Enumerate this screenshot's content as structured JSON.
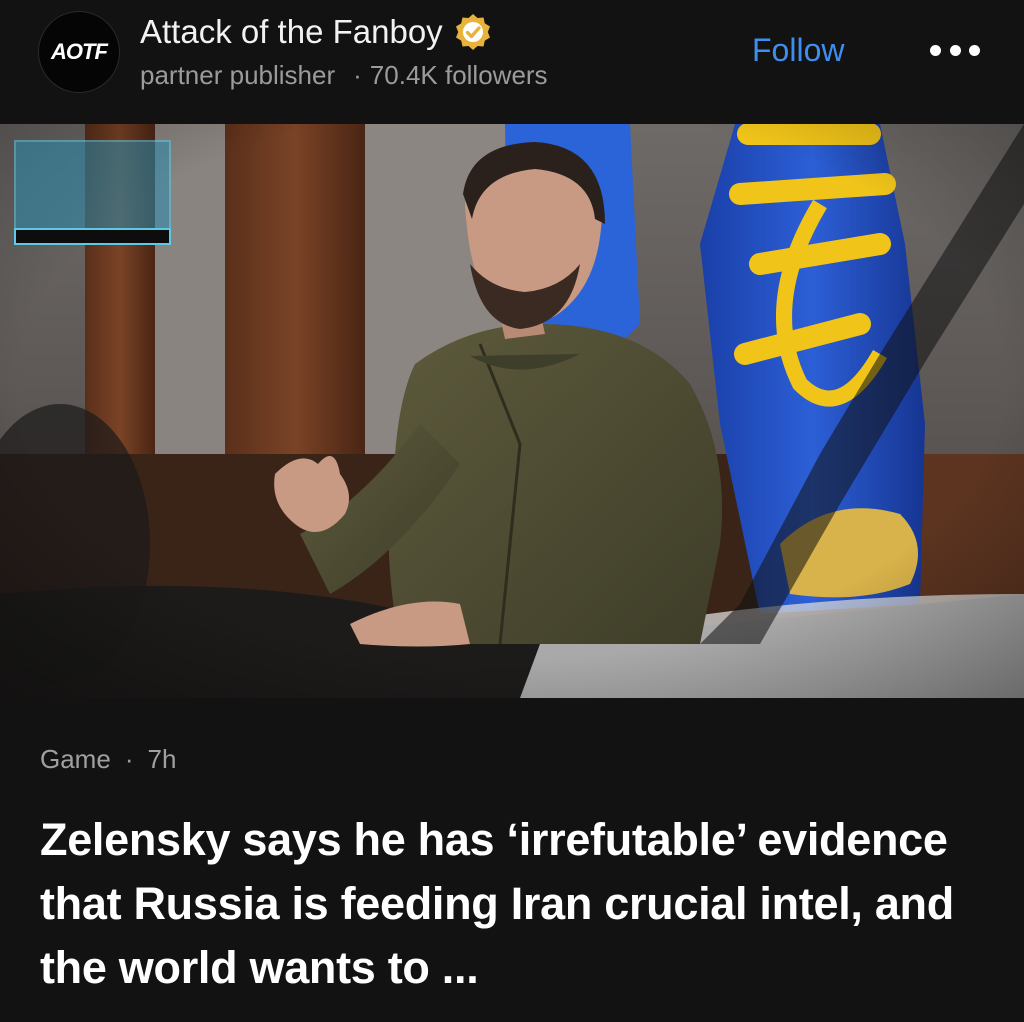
{
  "publisher": {
    "logo_text": "AOTF",
    "name": "Attack of the Fanboy",
    "type": "partner publisher",
    "separator": "·",
    "followers": "70.4K followers"
  },
  "actions": {
    "follow_label": "Follow",
    "more_icon": "more-horizontal-icon"
  },
  "article": {
    "category": "Game",
    "separator": "·",
    "age": "7h",
    "headline": "Zelensky says he has ‘irrefutable’ evidence that Russia is feeding Iran crucial intel, and the world wants to ..."
  },
  "colors": {
    "background": "#121212",
    "accent": "#3d8ef0",
    "verified_badge": "#e8b33a",
    "flag_blue": "#1f4fc2",
    "flag_yellow": "#f0c419"
  }
}
